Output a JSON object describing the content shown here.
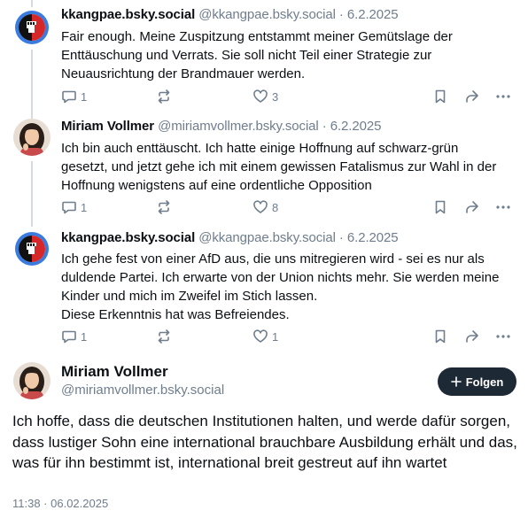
{
  "replies": [
    {
      "author_name": "kkangpae.bsky.social",
      "handle": "@kkangpae.bsky.social",
      "separator": "·",
      "date": "6.2.2025",
      "text": "Fair enough. Meine Zuspitzung entstammt meiner Gemütslage der Enttäuschung und Verrats. Sie soll nicht Teil einer Strategie zur Neuausrichtung der Brandmauer werden.",
      "reply_count": "1",
      "repost_count": "",
      "like_count": "3"
    },
    {
      "author_name": "Miriam Vollmer",
      "handle": "@miriamvollmer.bsky.social",
      "separator": "·",
      "date": "6.2.2025",
      "text": "Ich bin auch enttäuscht. Ich hatte einige Hoffnung auf schwarz-grün gesetzt, und jetzt gehe ich mit einem gewissen Fatalismus zur Wahl in der Hoffnung wenigstens auf eine ordentliche Opposition",
      "reply_count": "1",
      "repost_count": "",
      "like_count": "8"
    },
    {
      "author_name": "kkangpae.bsky.social",
      "handle": "@kkangpae.bsky.social",
      "separator": "·",
      "date": "6.2.2025",
      "text": "Ich gehe fest von einer AfD aus, die uns mitregieren wird - sei es nur als duldende Partei. Ich erwarte von der Union nichts mehr. Sie werden meine Kinder und mich im Zweifel im Stich lassen.\nDiese Erkenntnis hat was Befreiendes.",
      "reply_count": "1",
      "repost_count": "",
      "like_count": "1"
    }
  ],
  "main_post": {
    "author_name": "Miriam Vollmer",
    "handle": "@miriamvollmer.bsky.social",
    "follow_label": "Folgen",
    "text": "Ich hoffe, dass die deutschen Institutionen halten, und werde dafür sorgen, dass lustiger Sohn eine international brauchbare Ausbildung erhält und das, was für ihn bestimmt ist, international breit gestreut auf ihn wartet",
    "timestamp": "11:38 · 06.02.2025"
  },
  "icons": {
    "reply": "speech-bubble-icon",
    "repost": "repost-arrows-icon",
    "like": "heart-icon",
    "bookmark": "bookmark-icon",
    "share": "share-arrow-icon",
    "more": "ellipsis-icon",
    "follow": "plus-icon"
  },
  "colors": {
    "muted_text": "#6f7d8c",
    "follow_button_bg": "#1e2936",
    "thread_line": "#d4dbe2",
    "kkangpae_avatar_bg": "#3a7be0"
  }
}
